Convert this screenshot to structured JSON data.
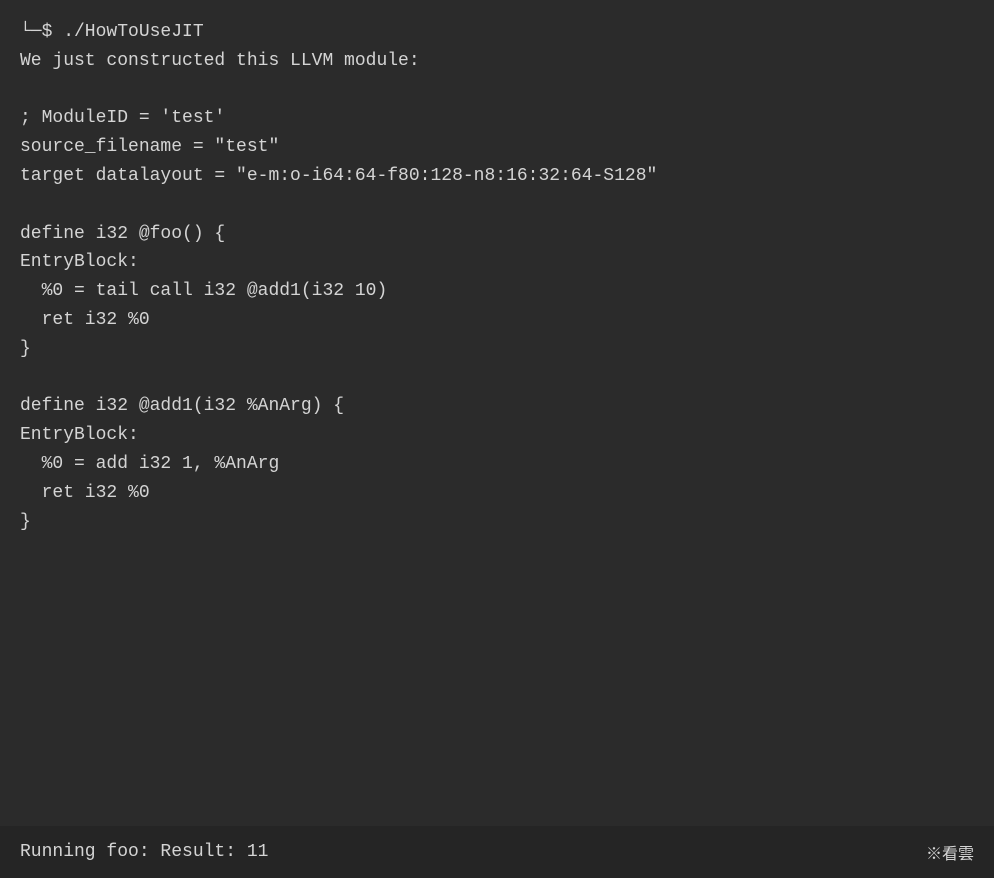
{
  "terminal": {
    "background": "#2b2b2b",
    "prompt_line": "└─$ ./HowToUseJIT",
    "intro_line": "We just constructed this LLVM module:",
    "empty1": "",
    "module_id": "; ModuleID = 'test'",
    "source_filename": "source_filename = \"test\"",
    "target_datalayout": "target datalayout = \"e-m:o-i64:64-f80:128-n8:16:32:64-S128\"",
    "empty2": "",
    "define_foo": "define i32 @foo() {",
    "entry_block_foo": "EntryBlock:",
    "foo_body1": "  %0 = tail call i32 @add1(i32 10)",
    "foo_body2": "  ret i32 %0",
    "foo_close": "}",
    "empty3": "",
    "define_add1": "define i32 @add1(i32 %AnArg) {",
    "entry_block_add1": "EntryBlock:",
    "add1_body1": "  %0 = add i32 1, %AnArg",
    "add1_body2": "  ret i32 %0",
    "add1_close": "}",
    "empty4": "",
    "empty5": "",
    "empty6": "",
    "result_line": "Running foo: Result: 11",
    "icon_label": "※看雲"
  }
}
